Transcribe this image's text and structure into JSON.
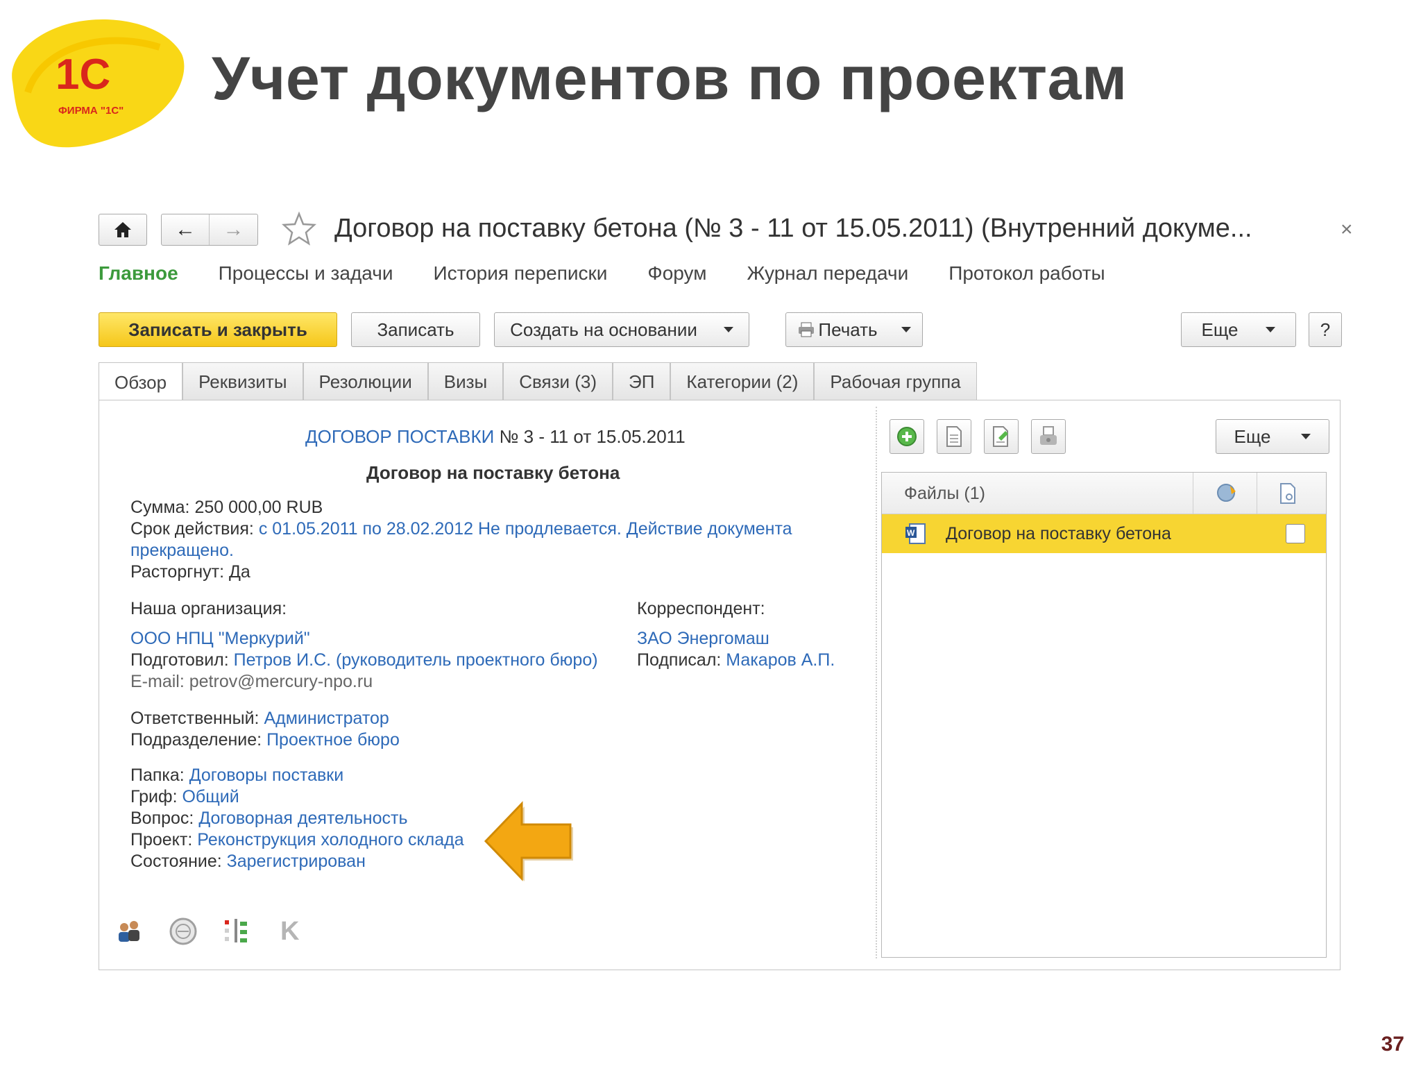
{
  "slide": {
    "title": "Учет документов по проектам",
    "number": "37",
    "logo_text": "1С",
    "logo_subtext": "ФИРМА \"1С\""
  },
  "window": {
    "title": "Договор на поставку бетона (№ 3 - 11 от 15.05.2011) (Внутренний докуме...",
    "close": "×",
    "back_glyph": "←",
    "forward_glyph": "→"
  },
  "section_tabs": [
    "Главное",
    "Процессы и задачи",
    "История переписки",
    "Форум",
    "Журнал передачи",
    "Протокол работы"
  ],
  "commands": {
    "save_close": "Записать и закрыть",
    "save": "Записать",
    "create_based": "Создать на основании",
    "print": "Печать",
    "more": "Еще",
    "help": "?"
  },
  "tabs": [
    "Обзор",
    "Реквизиты",
    "Резолюции",
    "Визы",
    "Связи (3)",
    "ЭП",
    "Категории (2)",
    "Рабочая группа"
  ],
  "document": {
    "type_link": "ДОГОВОР ПОСТАВКИ",
    "number_text": " № 3 - 11 от 15.05.2011",
    "title": "Договор на поставку бетона",
    "sum_label": "Сумма:",
    "sum_value": " 250 000,00 RUB",
    "validity_label": "Срок действия:",
    "validity_value_1": " с 01.05.2011 по 28.02.2012 Не продлевается. Действие документа",
    "validity_value_2": "прекращено.",
    "terminated_label": "Расторгнут:",
    "terminated_value": " Да",
    "our_org_label": "Наша организация:",
    "our_org_value": "ООО НПЦ \"Меркурий\"",
    "prepared_label": "Подготовил:",
    "prepared_value": " Петров И.С. (руководитель проектного бюро)",
    "email_label": "E-mail:",
    "email_value": " petrov@mercury-npo.ru",
    "correspondent_label": "Корреспондент:",
    "correspondent_value": "ЗАО Энергомаш",
    "signed_label": "Подписал:",
    "signed_value": " Макаров А.П.",
    "responsible_label": "Ответственный:",
    "responsible_value": " Администратор",
    "department_label": "Подразделение:",
    "department_value": " Проектное бюро",
    "folder_label": "Папка:",
    "folder_value": " Договоры поставки",
    "stamp_label": "Гриф:",
    "stamp_value": " Общий",
    "question_label": "Вопрос:",
    "question_value": " Договорная деятельность",
    "project_label": "Проект:",
    "project_value": " Реконструкция холодного склада",
    "state_label": "Состояние:",
    "state_value": " Зарегистрирован",
    "k_glyph": "K"
  },
  "files": {
    "more": "Еще",
    "header": "Файлы (1)",
    "rows": [
      {
        "name": "Договор на поставку бетона"
      }
    ]
  },
  "colors": {
    "accent_green": "#3c9a3c",
    "link_blue": "#2e6ab8",
    "primary_yellow": "#f5c71a",
    "row_highlight": "#f7d532",
    "arrow_orange": "#f3a712"
  }
}
